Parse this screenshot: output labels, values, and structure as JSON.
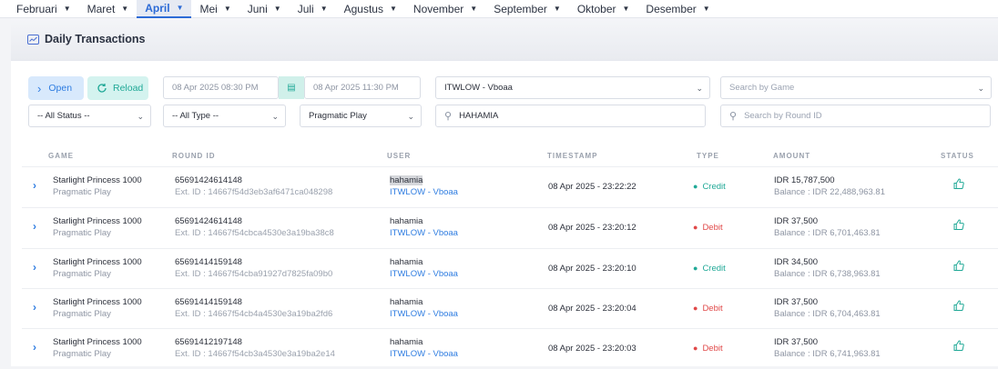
{
  "months": [
    {
      "label": "Februari",
      "active": false
    },
    {
      "label": "Maret",
      "active": false
    },
    {
      "label": "April",
      "active": true
    },
    {
      "label": "Mei",
      "active": false
    },
    {
      "label": "Juni",
      "active": false
    },
    {
      "label": "Juli",
      "active": false
    },
    {
      "label": "Agustus",
      "active": false
    },
    {
      "label": "November",
      "active": false
    },
    {
      "label": "September",
      "active": false
    },
    {
      "label": "Oktober",
      "active": false
    },
    {
      "label": "Desember",
      "active": false
    }
  ],
  "page": {
    "title": "Daily Transactions",
    "icon": "chart-icon"
  },
  "toolbar": {
    "open_label": "Open",
    "reload_label": "Reload",
    "date_from": "08 Apr 2025 08:30 PM",
    "date_to": "08 Apr 2025 11:30 PM",
    "agent": "ITWLOW - Vboaa",
    "game_placeholder": "Search by Game",
    "status": "-- All Status --",
    "type": "-- All Type --",
    "provider": "Pragmatic Play",
    "user_search": "HAHAMIA",
    "round_placeholder": "Search by Round ID"
  },
  "table": {
    "headers": [
      "GAME",
      "ROUND ID",
      "USER",
      "TIMESTAMP",
      "TYPE",
      "AMOUNT",
      "STATUS"
    ],
    "rows": [
      {
        "game": "Starlight Princess 1000",
        "provider": "Pragmatic Play",
        "round_id": "65691424614148",
        "ext_id": "Ext. ID : 14667f54d3eb3af6471ca048298",
        "user": "hahamia",
        "agent": "ITWLOW - Vboaa",
        "timestamp": "08 Apr 2025 - 23:22:22",
        "type": "Credit",
        "amount": "IDR 15,787,500",
        "balance": "Balance : IDR 22,488,963.81"
      },
      {
        "game": "Starlight Princess 1000",
        "provider": "Pragmatic Play",
        "round_id": "65691424614148",
        "ext_id": "Ext. ID : 14667f54cbca4530e3a19ba38c8",
        "user": "hahamia",
        "agent": "ITWLOW - Vboaa",
        "timestamp": "08 Apr 2025 - 23:20:12",
        "type": "Debit",
        "amount": "IDR 37,500",
        "balance": "Balance : IDR 6,701,463.81"
      },
      {
        "game": "Starlight Princess 1000",
        "provider": "Pragmatic Play",
        "round_id": "65691414159148",
        "ext_id": "Ext. ID : 14667f54cba91927d7825fa09b0",
        "user": "hahamia",
        "agent": "ITWLOW - Vboaa",
        "timestamp": "08 Apr 2025 - 23:20:10",
        "type": "Credit",
        "amount": "IDR 34,500",
        "balance": "Balance : IDR 6,738,963.81"
      },
      {
        "game": "Starlight Princess 1000",
        "provider": "Pragmatic Play",
        "round_id": "65691414159148",
        "ext_id": "Ext. ID : 14667f54cb4a4530e3a19ba2fd6",
        "user": "hahamia",
        "agent": "ITWLOW - Vboaa",
        "timestamp": "08 Apr 2025 - 23:20:04",
        "type": "Debit",
        "amount": "IDR 37,500",
        "balance": "Balance : IDR 6,704,463.81"
      },
      {
        "game": "Starlight Princess 1000",
        "provider": "Pragmatic Play",
        "round_id": "65691412197148",
        "ext_id": "Ext. ID : 14667f54cb3a4530e3a19ba2e14",
        "user": "hahamia",
        "agent": "ITWLOW - Vboaa",
        "timestamp": "08 Apr 2025 - 23:20:03",
        "type": "Debit",
        "amount": "IDR 37,500",
        "balance": "Balance : IDR 6,741,963.81"
      }
    ]
  },
  "colors": {
    "accent": "#2f7de1",
    "credit": "#21a997",
    "debit": "#e04848"
  }
}
